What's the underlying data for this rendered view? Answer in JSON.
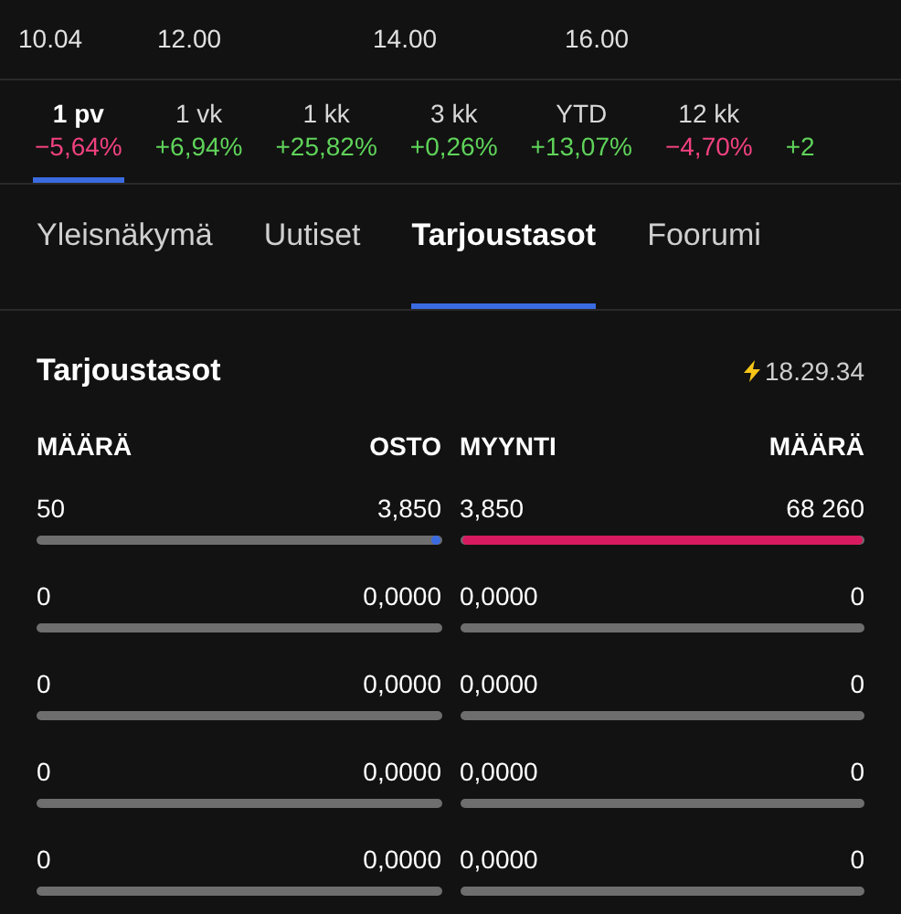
{
  "chart_axis": {
    "labels": [
      "10.04",
      "12.00",
      "14.00",
      "16.00"
    ]
  },
  "periods": [
    {
      "label": "1 pv",
      "change": "−5,64%",
      "color": "#f0417f",
      "selected": true
    },
    {
      "label": "1 vk",
      "change": "+6,94%",
      "color": "#5fd35a",
      "selected": false
    },
    {
      "label": "1 kk",
      "change": "+25,82%",
      "color": "#5fd35a",
      "selected": false
    },
    {
      "label": "3 kk",
      "change": "+0,26%",
      "color": "#5fd35a",
      "selected": false
    },
    {
      "label": "YTD",
      "change": "+13,07%",
      "color": "#5fd35a",
      "selected": false
    },
    {
      "label": "12 kk",
      "change": "−4,70%",
      "color": "#f0417f",
      "selected": false
    },
    {
      "change": "+2",
      "color": "#5fd35a",
      "selected": false
    }
  ],
  "tabs": [
    {
      "label": "Yleisnäkymä",
      "selected": false
    },
    {
      "label": "Uutiset",
      "selected": false
    },
    {
      "label": "Tarjoustasot",
      "selected": true
    },
    {
      "label": "Foorumi",
      "selected": false
    }
  ],
  "order_book": {
    "title": "Tarjoustasot",
    "time": "18.29.34",
    "columns": [
      "MÄÄRÄ",
      "OSTO",
      "MYYNTI",
      "MÄÄRÄ"
    ],
    "rows": [
      {
        "bid_volume": "50",
        "bid": "3,850",
        "bid_bar": {
          "level": 0.02
        },
        "ask": "3,850",
        "ask_volume": "68 260",
        "ask_bar": {
          "level": 1
        }
      },
      {
        "bid_volume": "0",
        "bid": "0,0000",
        "bid_bar": {
          "level": 0
        },
        "ask": "0,0000",
        "ask_volume": "0",
        "ask_bar": {
          "level": 0
        }
      },
      {
        "bid_volume": "0",
        "bid": "0,0000",
        "bid_bar": {
          "level": 0
        },
        "ask": "0,0000",
        "ask_volume": "0",
        "ask_bar": {
          "level": 0
        }
      },
      {
        "bid_volume": "0",
        "bid": "0,0000",
        "bid_bar": {
          "level": 0
        },
        "ask": "0,0000",
        "ask_volume": "0",
        "ask_bar": {
          "level": 0
        }
      },
      {
        "bid_volume": "0",
        "bid": "0,0000",
        "bid_bar": {
          "level": 0
        },
        "ask": "0,0000",
        "ask_volume": "0",
        "ask_bar": {
          "level": 0
        }
      }
    ]
  }
}
